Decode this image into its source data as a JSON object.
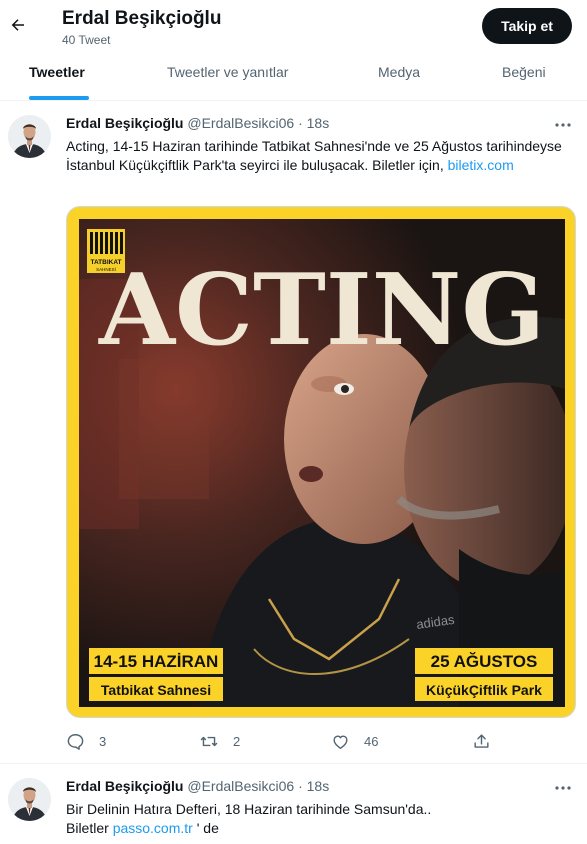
{
  "header": {
    "back_icon": "arrow-left-icon",
    "name": "Erdal Beşikçioğlu",
    "tweet_count": "40 Tweet",
    "follow_label": "Takip et"
  },
  "tabs": [
    {
      "label": "Tweetler",
      "active": true
    },
    {
      "label": "Tweetler ve yanıtlar",
      "active": false
    },
    {
      "label": "Medya",
      "active": false
    },
    {
      "label": "Beğeni",
      "active": false
    }
  ],
  "tweets": [
    {
      "name": "Erdal Beşikçioğlu",
      "handle": "@ErdalBesikci06",
      "dot": "·",
      "time": "18s",
      "text": "Acting, 14-15 Haziran tarihinde Tatbikat Sahnesi'nde ve 25 Ağustos tarihindeyse İstanbul Küçükçiftlik Park'ta seyirci ile buluşacak. Biletler için,",
      "link": "biletix.com",
      "poster": {
        "title": "ACTING",
        "logo_text": "TATBIKAT",
        "logo_subtext": "SAHNESİ",
        "shirt_text": "adidas",
        "left_date": "14-15 HAZİRAN",
        "left_venue": "Tatbikat Sahnesi",
        "right_date": "25 AĞUSTOS",
        "right_venue": "KüçükÇiftlik Park",
        "bg_color": "#fbd227"
      },
      "actions": {
        "replies": "3",
        "retweets": "2",
        "likes": "46"
      }
    },
    {
      "name": "Erdal Beşikçioğlu",
      "handle": "@ErdalBesikci06",
      "dot": "·",
      "time": "18s",
      "text_line1": "Bir Delinin Hatıra Defteri, 18 Haziran tarihinde Samsun'da..",
      "text_line2_pre": "Biletler ",
      "link": "passo.com.tr",
      "text_line2_post": " ' de"
    }
  ],
  "colors": {
    "accent": "#1d9bf0",
    "text": "#0f1419",
    "muted": "#536471",
    "poster_yellow": "#fbd227"
  }
}
